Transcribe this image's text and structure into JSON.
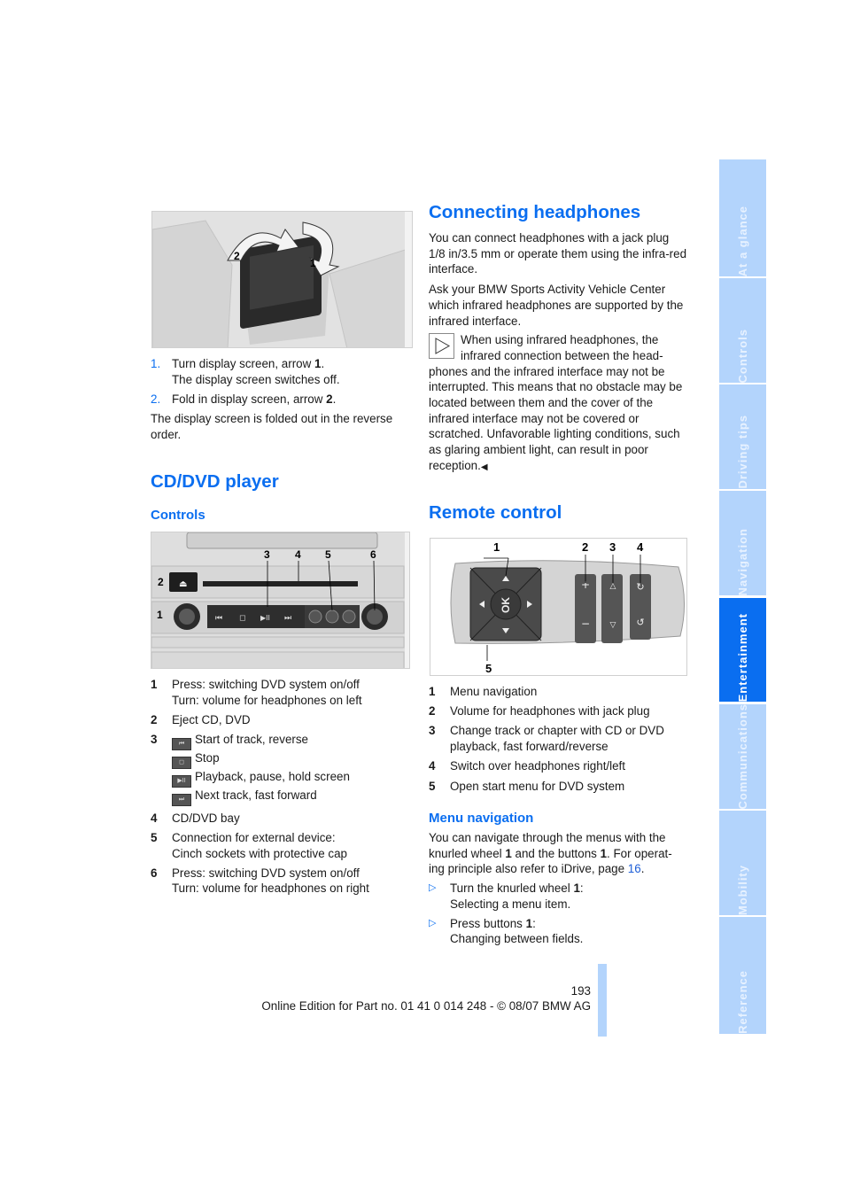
{
  "side_tabs": [
    {
      "label": "At a glance",
      "active": false
    },
    {
      "label": "Controls",
      "active": false
    },
    {
      "label": "Driving tips",
      "active": false
    },
    {
      "label": "Navigation",
      "active": false
    },
    {
      "label": "Entertainment",
      "active": true
    },
    {
      "label": "Communications",
      "active": false
    },
    {
      "label": "Mobility",
      "active": false
    },
    {
      "label": "Reference",
      "active": false
    }
  ],
  "left": {
    "fold_figure": {
      "callouts": [
        "1",
        "2"
      ]
    },
    "steps": [
      {
        "num": "1.",
        "text": "Turn display screen, arrow ",
        "bold": "1",
        "after": ".",
        "line2": "The display screen switches off."
      },
      {
        "num": "2.",
        "text": "Fold in display screen, arrow ",
        "bold": "2",
        "after": "."
      }
    ],
    "fold_note": "The display screen is folded out in the reverse order.",
    "cd_heading": "CD/DVD player",
    "controls_heading": "Controls",
    "controls_figure": {
      "callouts": [
        "1",
        "2",
        "3",
        "4",
        "5",
        "6"
      ],
      "buttons": [
        "⏮",
        "◻",
        "▶II",
        "⏭"
      ]
    },
    "controls_list": [
      {
        "num": "1",
        "lines": [
          "Press: switching DVD system on/off",
          "Turn: volume for headphones on left"
        ]
      },
      {
        "num": "2",
        "lines": [
          "Eject CD, DVD"
        ]
      },
      {
        "num": "3",
        "icon_lines": [
          {
            "icon": "⏮",
            "text": "Start of track, reverse"
          },
          {
            "icon": "◻",
            "text": "Stop"
          },
          {
            "icon": "▶II",
            "text": "Playback, pause, hold screen"
          },
          {
            "icon": "⏭",
            "text": "Next track, fast forward"
          }
        ]
      },
      {
        "num": "4",
        "lines": [
          "CD/DVD bay"
        ]
      },
      {
        "num": "5",
        "lines": [
          "Connection for external device:",
          "Cinch sockets with protective cap"
        ]
      },
      {
        "num": "6",
        "lines": [
          "Press: switching DVD system on/off",
          "Turn: volume for headphones on right"
        ]
      }
    ]
  },
  "right": {
    "headphones_heading": "Connecting headphones",
    "headphones_p1": "You can connect headphones with a jack plug 1/8 in/3.5 mm or operate them using the infra-red interface.",
    "headphones_p2": "Ask your BMW Sports Activity Vehicle Center which infrared headphones are supported by the infrared interface.",
    "note_text": "When using infrared headphones, the infrared connection between the head-phones and the infrared interface may not be interrupted. This means that no obstacle may be located between them and the cover of the infrared interface may not be covered or scratched. Unfavorable lighting conditions, such as glaring ambient light, can result in poor reception.",
    "note_end": "◀",
    "remote_heading": "Remote control",
    "remote_figure": {
      "callouts": [
        "1",
        "2",
        "3",
        "4",
        "5"
      ],
      "ok_label": "OK"
    },
    "remote_list": [
      {
        "num": "1",
        "lines": [
          "Menu navigation"
        ]
      },
      {
        "num": "2",
        "lines": [
          "Volume for headphones with jack plug"
        ]
      },
      {
        "num": "3",
        "lines": [
          "Change track or chapter with CD or DVD",
          "playback, fast forward/reverse"
        ]
      },
      {
        "num": "4",
        "lines": [
          "Switch over headphones right/left"
        ]
      },
      {
        "num": "5",
        "lines": [
          "Open start menu for DVD system"
        ]
      }
    ],
    "menu_nav_heading": "Menu navigation",
    "menu_nav_p1_a": "You can navigate through the menus with the knurled wheel ",
    "menu_nav_p1_b1": "1",
    "menu_nav_p1_c": " and the buttons ",
    "menu_nav_p1_b2": "1",
    "menu_nav_p1_d": ". For operat-ing principle also refer to iDrive, page ",
    "menu_nav_page_link": "16",
    "menu_nav_p1_e": ".",
    "bullets": [
      {
        "text": "Turn the knurled wheel ",
        "bold": "1",
        "after": ":",
        "line2": "Selecting a menu item."
      },
      {
        "text": "Press buttons ",
        "bold": "1",
        "after": ":",
        "line2": "Changing between fields."
      }
    ],
    "bullet_glyph": "▷"
  },
  "footer": {
    "page_number": "193",
    "edition": "Online Edition for Part no. 01 41 0 014 248 - © 08/07 BMW AG"
  }
}
